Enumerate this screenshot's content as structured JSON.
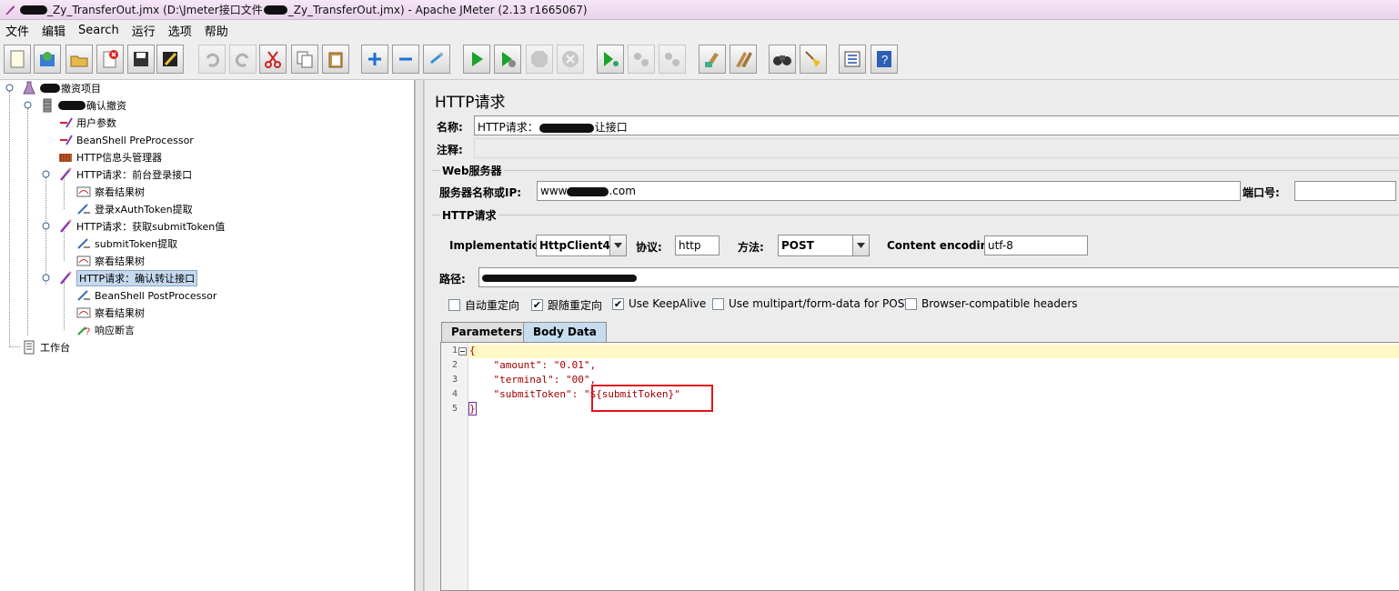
{
  "window": {
    "title_prefix": "_Zy_TransferOut.jmx (D:\\Jmeter接口文件",
    "title_suffix": "_Zy_TransferOut.jmx) - Apache JMeter (2.13 r1665067)"
  },
  "menu": [
    "文件",
    "编辑",
    "Search",
    "运行",
    "选项",
    "帮助"
  ],
  "toolbar": [
    {
      "icon": "new-icon",
      "enabled": true
    },
    {
      "icon": "templates-icon",
      "enabled": true
    },
    {
      "icon": "open-icon",
      "enabled": true
    },
    {
      "icon": "close-icon",
      "enabled": true
    },
    {
      "icon": "save-icon",
      "enabled": true
    },
    {
      "icon": "save-as-icon",
      "enabled": true
    },
    {
      "icon": "undo-icon",
      "enabled": false
    },
    {
      "icon": "redo-icon",
      "enabled": false
    },
    {
      "icon": "cut-icon",
      "enabled": true
    },
    {
      "icon": "copy-icon",
      "enabled": true
    },
    {
      "icon": "paste-icon",
      "enabled": true
    },
    {
      "icon": "expand-icon",
      "enabled": true
    },
    {
      "icon": "collapse-icon",
      "enabled": true
    },
    {
      "icon": "toggle-icon",
      "enabled": true
    },
    {
      "icon": "start-icon",
      "enabled": true
    },
    {
      "icon": "start-no-pause-icon",
      "enabled": true
    },
    {
      "icon": "stop-icon",
      "enabled": false
    },
    {
      "icon": "shutdown-icon",
      "enabled": false
    },
    {
      "icon": "remote-start-icon",
      "enabled": true
    },
    {
      "icon": "remote-stop-icon",
      "enabled": false
    },
    {
      "icon": "remote-shutdown-icon",
      "enabled": false
    },
    {
      "icon": "clear-icon",
      "enabled": true
    },
    {
      "icon": "clear-all-icon",
      "enabled": true
    },
    {
      "icon": "search-icon",
      "enabled": true
    },
    {
      "icon": "reset-search-icon",
      "enabled": true
    },
    {
      "icon": "function-helper-icon",
      "enabled": true
    },
    {
      "icon": "help-icon",
      "enabled": true
    }
  ],
  "tree": [
    {
      "label": "撤资项目",
      "icon": "test-plan-icon"
    },
    {
      "label": "确认撤资",
      "icon": "thread-group-icon"
    },
    {
      "label": "用户参数",
      "icon": "preprocessor-icon"
    },
    {
      "label": "BeanShell PreProcessor",
      "icon": "preprocessor-icon"
    },
    {
      "label": "HTTP信息头管理器",
      "icon": "header-manager-icon"
    },
    {
      "label": "HTTP请求：前台登录接口",
      "icon": "sampler-icon"
    },
    {
      "label": "察看结果树",
      "icon": "listener-icon"
    },
    {
      "label": "登录xAuthToken提取",
      "icon": "postprocessor-icon"
    },
    {
      "label": "HTTP请求：获取submitToken值",
      "icon": "sampler-icon"
    },
    {
      "label": "submitToken提取",
      "icon": "postprocessor-icon"
    },
    {
      "label": "察看结果树",
      "icon": "listener-icon"
    },
    {
      "label": "HTTP请求：确认转让接口",
      "icon": "sampler-icon"
    },
    {
      "label": "BeanShell PostProcessor",
      "icon": "postprocessor-icon"
    },
    {
      "label": "察看结果树",
      "icon": "listener-icon"
    },
    {
      "label": "响应断言",
      "icon": "assertion-icon"
    },
    {
      "label": "工作台",
      "icon": "workbench-icon"
    }
  ],
  "panel": {
    "title": "HTTP请求",
    "name_label": "名称:",
    "name_value_prefix": "HTTP请求：",
    "name_value_suffix": "让接口",
    "comment_label": "注释:",
    "web_server_group": "Web服务器",
    "server_label": "服务器名称或IP:",
    "server_value_prefix": "www",
    "server_value_suffix": ".com",
    "port_label": "端口号:",
    "http_group": "HTTP请求",
    "impl_label": "Implementation:",
    "impl_value": "HttpClient4",
    "protocol_label": "协议:",
    "protocol_value": "http",
    "method_label": "方法:",
    "method_value": "POST",
    "encoding_label": "Content encoding:",
    "encoding_value": "utf-8",
    "path_label": "路径:",
    "checkboxes": [
      {
        "label": "自动重定向",
        "checked": false
      },
      {
        "label": "跟随重定向",
        "checked": true
      },
      {
        "label": "Use KeepAlive",
        "checked": true
      },
      {
        "label": "Use multipart/form-data for POST",
        "checked": false
      },
      {
        "label": "Browser-compatible headers",
        "checked": false
      }
    ],
    "tabs": [
      "Parameters",
      "Body Data"
    ],
    "active_tab": "Body Data",
    "body_lines": [
      {
        "num": "1",
        "text": "{"
      },
      {
        "num": "2",
        "text": "    \"amount\": \"0.01\","
      },
      {
        "num": "3",
        "text": "    \"terminal\": \"00\","
      },
      {
        "num": "4",
        "text": "    \"submitToken\": \"${submitToken}\""
      },
      {
        "num": "5",
        "text": "}"
      }
    ]
  }
}
